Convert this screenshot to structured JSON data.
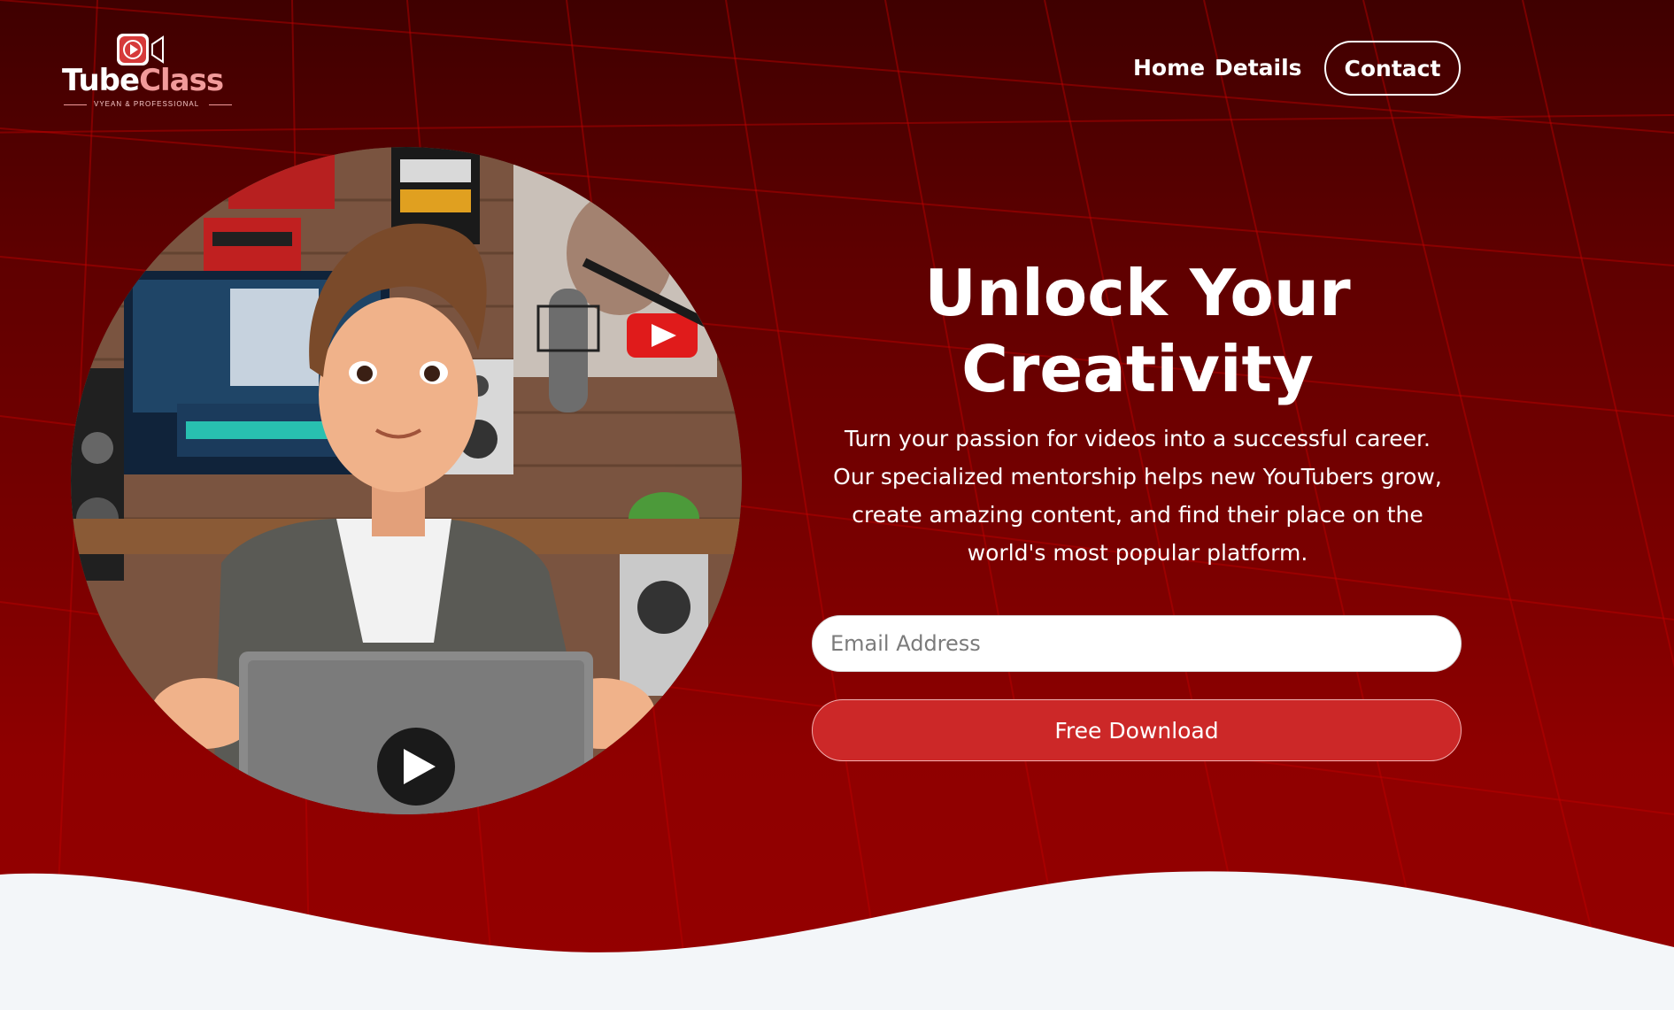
{
  "brand": {
    "name_part1": "Tube",
    "name_part2": "Class",
    "tagline": "VYEAN & PROFESSIONAL"
  },
  "nav": {
    "items": [
      {
        "label": "Home"
      },
      {
        "label": "Details"
      }
    ],
    "contact_label": "Contact"
  },
  "hero": {
    "title": "Unlock Your Creativity",
    "description": "Turn your passion for videos into a successful career. Our specialized mentorship helps new YouTubers grow, create amazing content, and find their place on the world's most popular platform.",
    "email_placeholder": "Email Address",
    "cta_label": "Free Download"
  },
  "colors": {
    "hero_background": "#7a0000",
    "button_red": "#cc2828",
    "footer_background": "#f3f6f9",
    "logo_accent": "#f19a9a"
  }
}
